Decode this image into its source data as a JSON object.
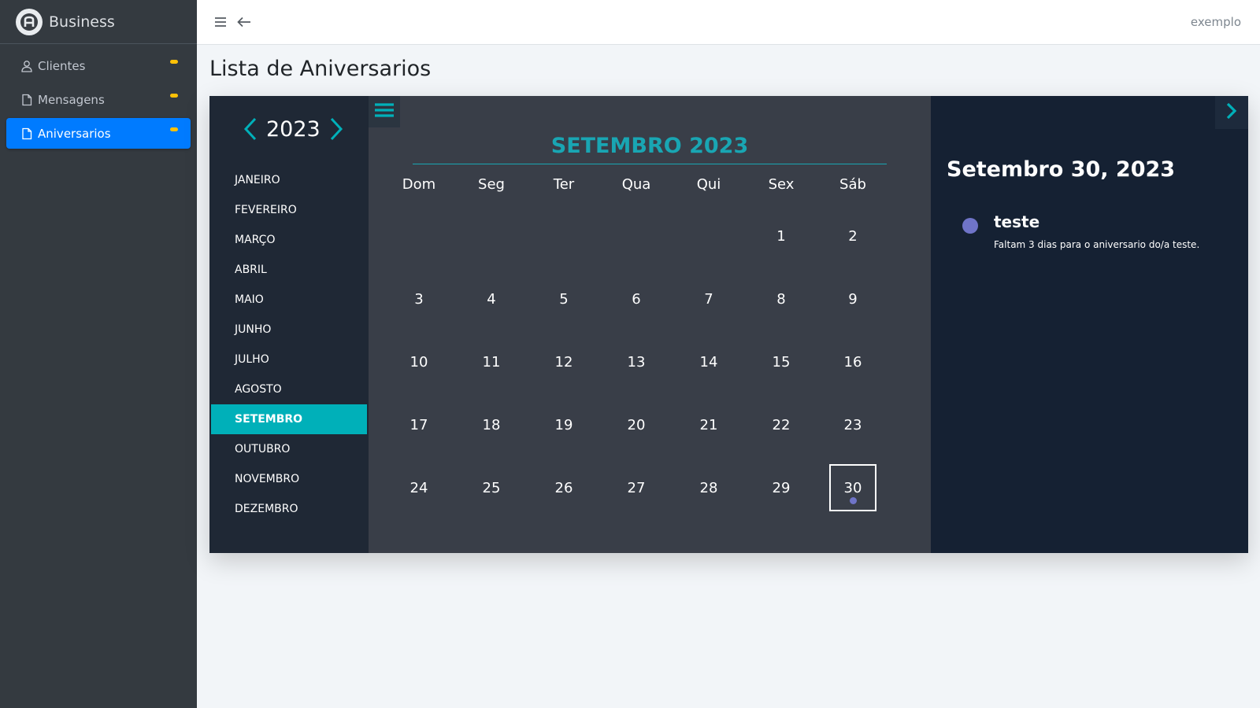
{
  "sidebar": {
    "brand": "Business",
    "items": [
      {
        "label": "Clientes",
        "icon": "user-icon"
      },
      {
        "label": "Mensagens",
        "icon": "file-icon"
      },
      {
        "label": "Aniversarios",
        "icon": "file-icon",
        "active": true
      }
    ],
    "badge_color": "#ffc107"
  },
  "topbar": {
    "user": "exemplo"
  },
  "page": {
    "title": "Lista de Aniversarios"
  },
  "calendar": {
    "year": "2023",
    "months": [
      "JANEIRO",
      "FEVEREIRO",
      "MARÇO",
      "ABRIL",
      "MAIO",
      "JUNHO",
      "JULHO",
      "AGOSTO",
      "SETEMBRO",
      "OUTUBRO",
      "NOVEMBRO",
      "DEZEMBRO"
    ],
    "selected_month": "SETEMBRO",
    "month_title": "SETEMBRO 2023",
    "weekdays": [
      "Dom",
      "Seg",
      "Ter",
      "Qua",
      "Qui",
      "Sex",
      "Sáb"
    ],
    "days": [
      "1",
      "2",
      "3",
      "4",
      "5",
      "6",
      "7",
      "8",
      "9",
      "10",
      "11",
      "12",
      "13",
      "14",
      "15",
      "16",
      "17",
      "18",
      "19",
      "20",
      "21",
      "22",
      "23",
      "24",
      "25",
      "26",
      "27",
      "28",
      "29",
      "30"
    ],
    "first_weekday_index": 5,
    "selected_day": "30",
    "accent_color": "#00b0b9",
    "event_color": "#6f74c8"
  },
  "events": {
    "date_title": "Setembro 30, 2023",
    "items": [
      {
        "name": "teste",
        "description": "Faltam 3 dias para o aniversario do/a teste."
      }
    ]
  }
}
